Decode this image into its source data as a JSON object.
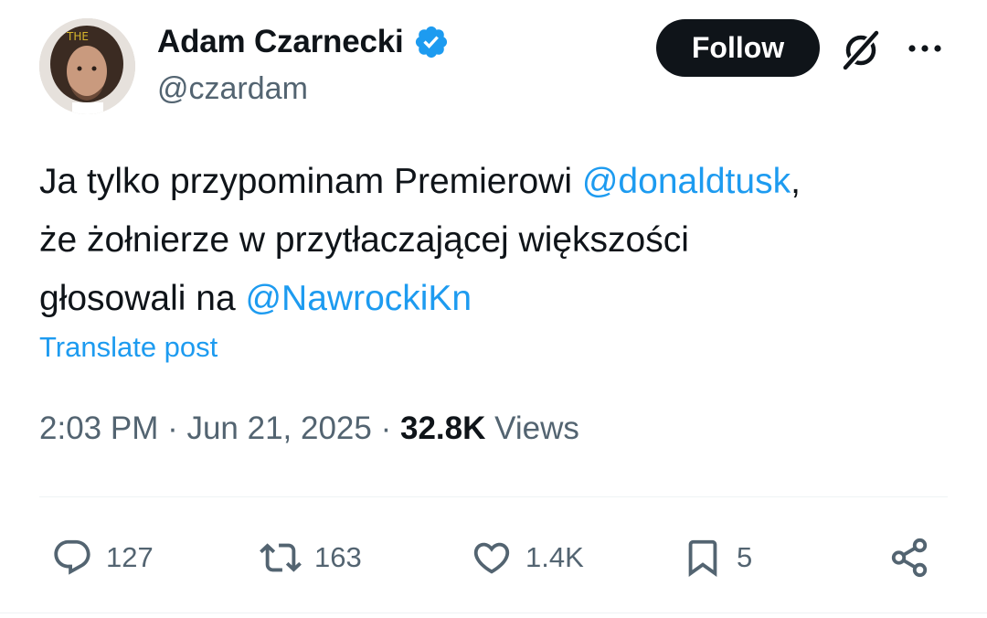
{
  "author": {
    "display_name": "Adam Czarnecki",
    "handle": "@czardam",
    "verified": true
  },
  "header": {
    "follow_label": "Follow",
    "icons": [
      "grok-icon",
      "more-icon"
    ]
  },
  "tweet": {
    "text_part1": "Ja tylko przypominam Premierowi ",
    "mention1": "@donaldtusk",
    "text_part2": ",",
    "line2": "że żołnierze w przytłaczającej większości",
    "text_part3": "głosowali na ",
    "mention2": "@NawrockiKn",
    "translate_label": "Translate post"
  },
  "meta": {
    "time": "2:03 PM",
    "sep1": " · ",
    "date": "Jun 21, 2025",
    "sep2": " · ",
    "views_count": "32.8K",
    "views_label": " Views"
  },
  "actions": {
    "replies": "127",
    "reposts": "163",
    "likes": "1.4K",
    "bookmarks": "5"
  },
  "colors": {
    "accent": "#1d9bf0",
    "text": "#0f1419",
    "muted": "#536471",
    "button_bg": "#0f1419"
  }
}
